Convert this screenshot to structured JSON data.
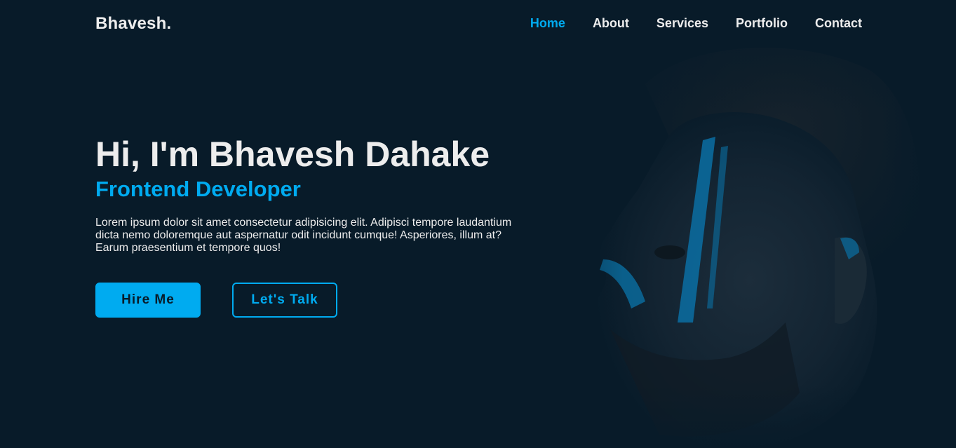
{
  "header": {
    "logo": "Bhavesh.",
    "nav": [
      {
        "label": "Home",
        "active": true
      },
      {
        "label": "About",
        "active": false
      },
      {
        "label": "Services",
        "active": false
      },
      {
        "label": "Portfolio",
        "active": false
      },
      {
        "label": "Contact",
        "active": false
      }
    ]
  },
  "hero": {
    "title": "Hi, I'm Bhavesh Dahake",
    "subtitle": "Frontend Developer",
    "description": "Lorem ipsum dolor sit amet consectetur adipisicing elit. Adipisci tempore laudantium dicta nemo doloremque aut aspernatur odit incidunt cumque! Asperiores, illum at? Earum praesentium et tempore quos!",
    "primary_button": "Hire Me",
    "secondary_button": "Let's Talk"
  },
  "colors": {
    "background": "#081b29",
    "accent": "#00abf0",
    "text": "#ededed"
  }
}
